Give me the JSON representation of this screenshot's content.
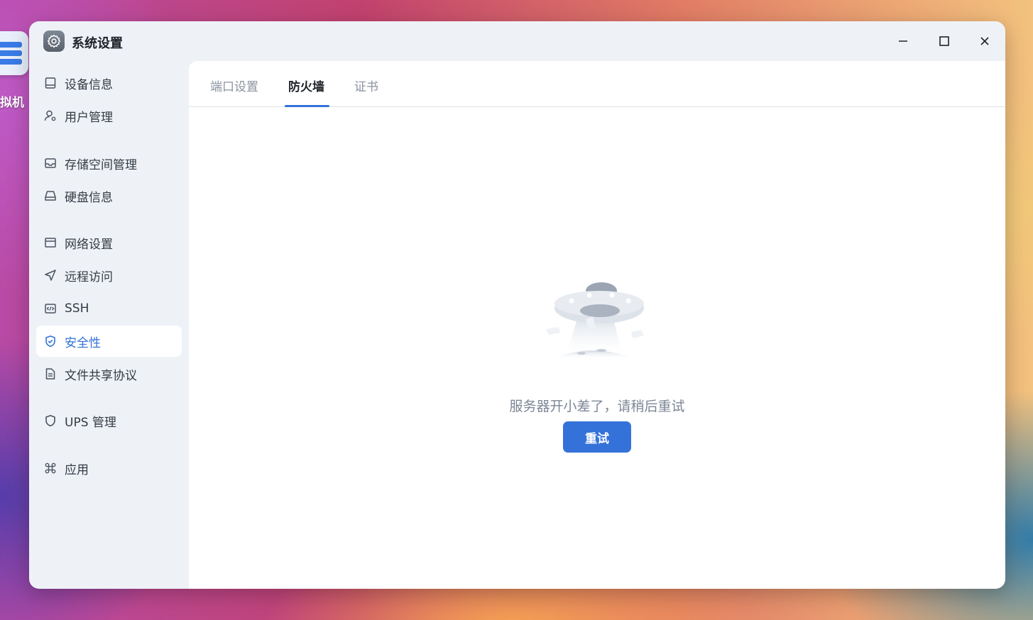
{
  "desktop": {
    "icon_label": "拟机"
  },
  "window": {
    "title": "系统设置",
    "controls": [
      "minimize",
      "maximize",
      "close"
    ]
  },
  "sidebar": {
    "items": [
      {
        "label": "设备信息",
        "icon": "device-icon"
      },
      {
        "label": "用户管理",
        "icon": "user-gear-icon"
      },
      {
        "label": "存储空间管理",
        "icon": "storage-icon"
      },
      {
        "label": "硬盘信息",
        "icon": "disk-icon"
      },
      {
        "label": "网络设置",
        "icon": "network-icon"
      },
      {
        "label": "远程访问",
        "icon": "send-icon"
      },
      {
        "label": "SSH",
        "icon": "code-icon"
      },
      {
        "label": "安全性",
        "icon": "shield-check-icon",
        "active": true
      },
      {
        "label": "文件共享协议",
        "icon": "document-icon"
      },
      {
        "label": "UPS 管理",
        "icon": "shield-icon"
      },
      {
        "label": "应用",
        "icon": "command-icon"
      }
    ]
  },
  "tabs": {
    "items": [
      {
        "label": "端口设置"
      },
      {
        "label": "防火墙",
        "active": true
      },
      {
        "label": "证书"
      }
    ]
  },
  "main": {
    "error_message": "服务器开小差了，请稍后重试",
    "retry_label": "重试"
  },
  "colors": {
    "accent": "#3472d9",
    "sidebar_bg": "#eef2f7",
    "content_bg": "#ffffff",
    "muted_text": "#7c8696"
  }
}
